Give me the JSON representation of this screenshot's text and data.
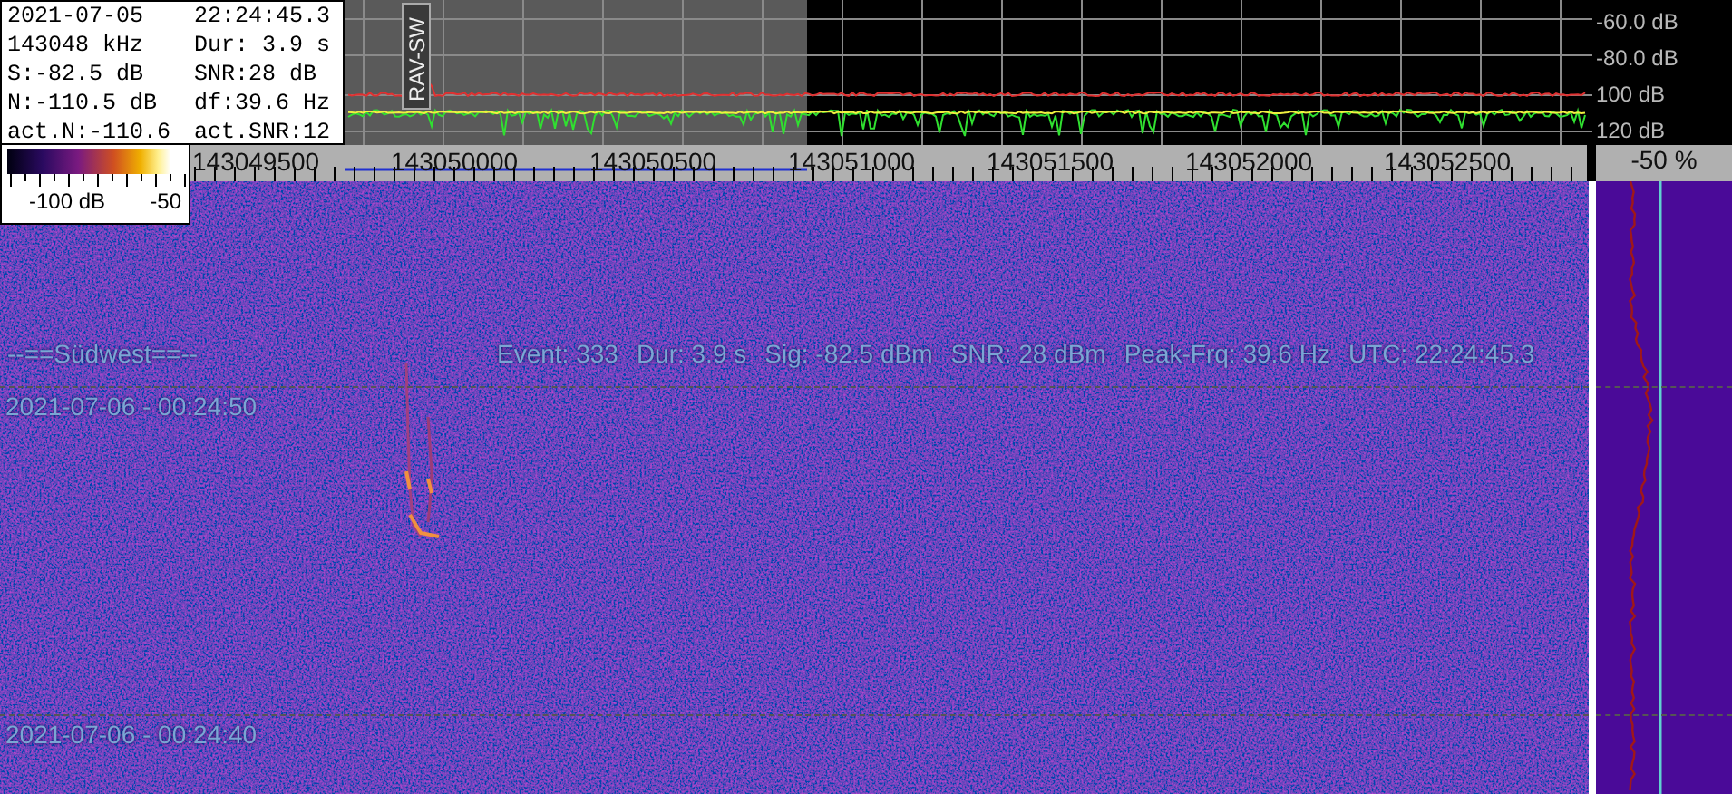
{
  "info_box": {
    "rows": [
      [
        "2021-07-05",
        "22:24:45.3"
      ],
      [
        "143048 kHz",
        "Dur: 3.9 s"
      ],
      [
        "S:-82.5 dB",
        "SNR:28 dB"
      ],
      [
        "N:-110.5 dB",
        "df:39.6 Hz"
      ],
      [
        "act.N:-110.6",
        "act.SNR:12"
      ]
    ]
  },
  "color_scale": {
    "labels": [
      "-100 dB",
      "-50"
    ]
  },
  "spectrum": {
    "marker_label": "RAV-SW",
    "db_ticks": [
      "-60.0 dB",
      "-80.0 dB",
      "100 dB",
      "120 dB"
    ]
  },
  "frequency_axis": {
    "labels": [
      "143049500",
      "143050000",
      "143050500",
      "143051000",
      "143051500",
      "143052000",
      "143052500"
    ],
    "percent": "-50 %"
  },
  "waterfall": {
    "station": "--==Südwest==--",
    "event_fields": [
      "Event: 333",
      "Dur: 3.9 s",
      "Sig: -82.5 dBm",
      "SNR: 28 dBm",
      "Peak-Frq: 39.6 Hz",
      "UTC: 22:24:45.3"
    ],
    "timestamps": [
      "2021-07-06 - 00:24:50",
      "2021-07-06 - 00:24:40"
    ]
  }
}
